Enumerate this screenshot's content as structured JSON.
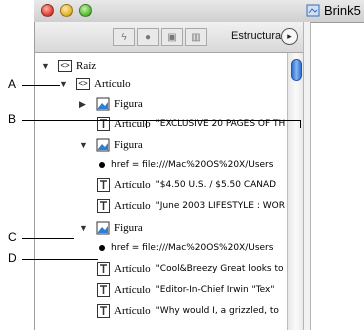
{
  "window": {
    "title": "Brink5"
  },
  "toolbar": {
    "label": "Estructura",
    "menu_glyph": "▸"
  },
  "tree": {
    "rows": [
      {
        "name": "Raíz",
        "value": ""
      },
      {
        "name": "Artículo",
        "value": ""
      },
      {
        "name": "Figura",
        "value": ""
      },
      {
        "name": "Artículo",
        "value": "\"EXCLUSIVE 20 PAGES OF TH"
      },
      {
        "name": "Figura",
        "value": ""
      },
      {
        "name": "",
        "value": "href = file:///Mac%20OS%20X/Users"
      },
      {
        "name": "Artículo",
        "value": "\"$4.50 U.S.  /  $5.50 CANAD"
      },
      {
        "name": "Artículo",
        "value": "\"June 2003  LIFESTYLE : WOR"
      },
      {
        "name": "Figura",
        "value": ""
      },
      {
        "name": "",
        "value": "href = file:///Mac%20OS%20X/Users"
      },
      {
        "name": "Artículo",
        "value": "\"Cool&Breezy Great looks to"
      },
      {
        "name": "Artículo",
        "value": "\"Editor-In-Chief Irwin \"Tex\""
      },
      {
        "name": "Artículo",
        "value": "\"Why would I, a grizzled, to"
      }
    ]
  },
  "callouts": {
    "a": "A",
    "b": "B",
    "c": "C",
    "d": "D"
  }
}
